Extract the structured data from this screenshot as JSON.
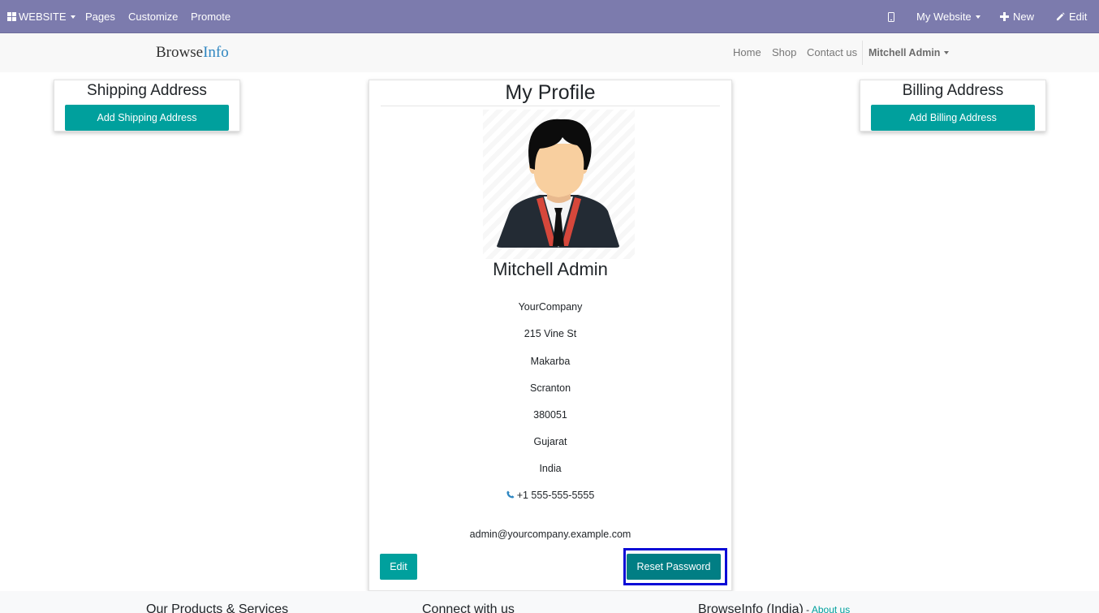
{
  "admin_bar": {
    "website_menu": "WEBSITE",
    "pages": "Pages",
    "customize": "Customize",
    "promote": "Promote",
    "mobile_icon": "mobile-icon",
    "my_website": "My Website",
    "new": "New",
    "edit": "Edit",
    "color": "#7c7bad"
  },
  "navbar": {
    "brand_prefix": "Browse",
    "brand_suffix": "Info",
    "links": [
      "Home",
      "Shop",
      "Contact us"
    ],
    "user": "Mitchell Admin"
  },
  "shipping": {
    "title": "Shipping Address",
    "button": "Add Shipping Address"
  },
  "billing": {
    "title": "Billing Address",
    "button": "Add Billing Address"
  },
  "profile": {
    "title": "My Profile",
    "name": "Mitchell Admin",
    "company": "YourCompany",
    "street": "215 Vine St",
    "street2": "Makarba",
    "city": "Scranton",
    "zip": "380051",
    "state": "Gujarat",
    "country": "India",
    "phone": "+1 555-555-5555",
    "email": "admin@yourcompany.example.com",
    "edit_button": "Edit",
    "reset_button": "Reset Password"
  },
  "footer": {
    "col1": "Our Products & Services",
    "col2": "Connect with us",
    "col3": "BrowseInfo (India)",
    "col3_sep": " - ",
    "col3_link": "About us"
  },
  "colors": {
    "accent": "#00a09d",
    "reset_button": "#017e84",
    "focus_ring": "#0b0bd6"
  }
}
